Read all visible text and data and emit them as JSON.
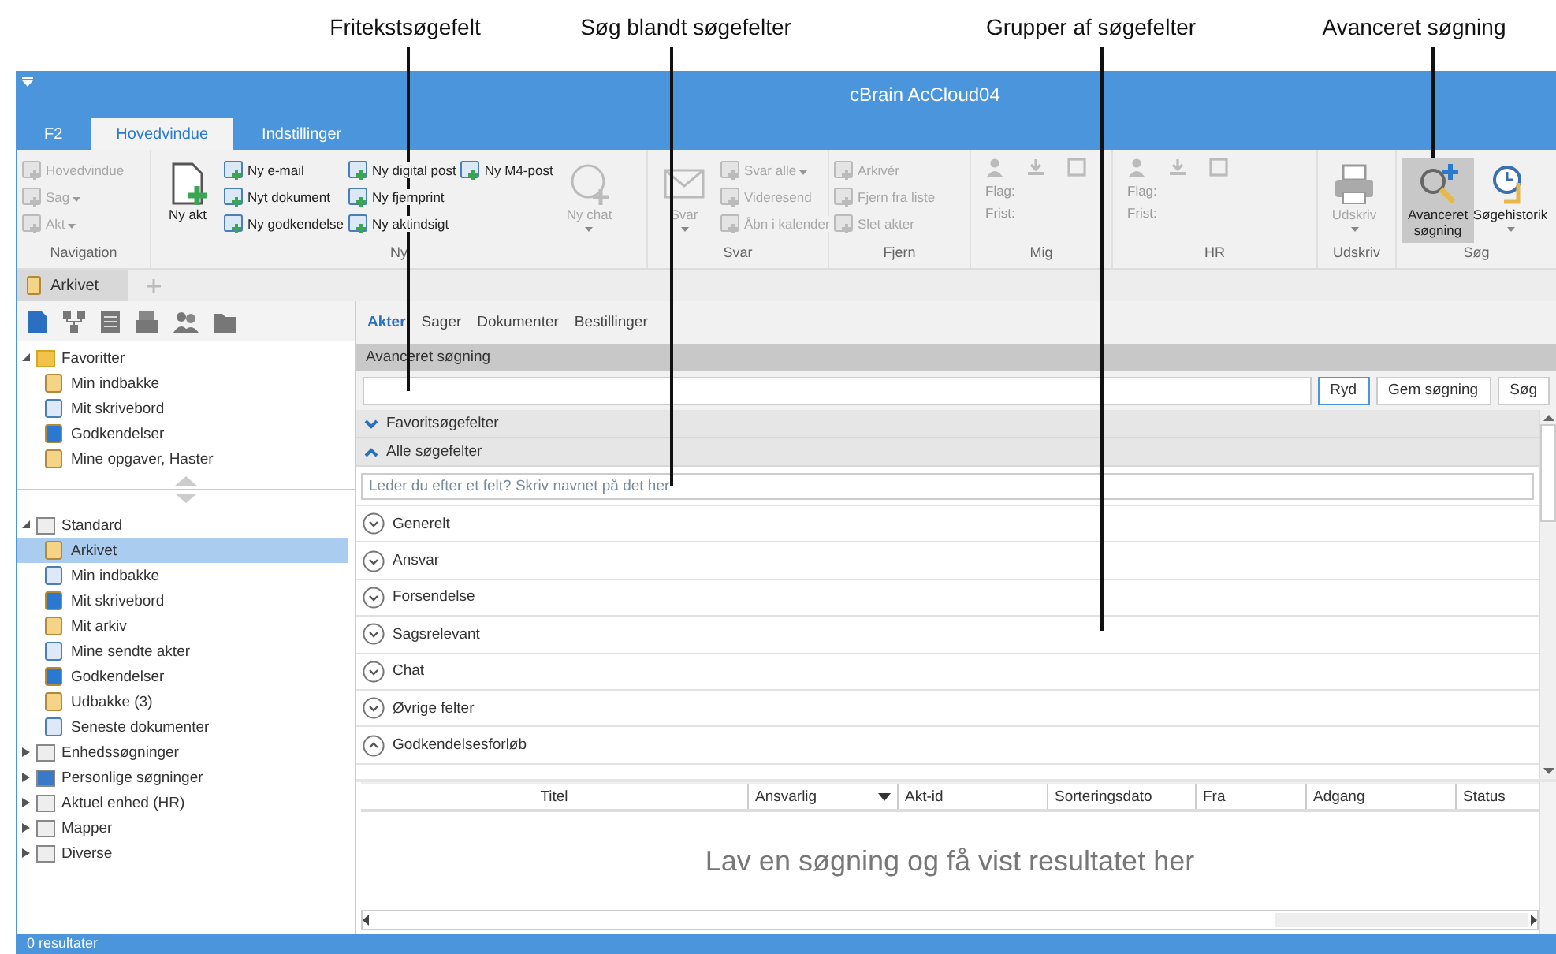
{
  "callouts": [
    {
      "label": "Fritekstsøgefelt"
    },
    {
      "label": "Søg blandt søgefelter"
    },
    {
      "label": "Grupper af søgefelter"
    },
    {
      "label": "Avanceret søgning"
    }
  ],
  "window": {
    "title": "cBrain AcCloud04"
  },
  "ribbon_tabs": [
    {
      "label": "F2",
      "selected": false
    },
    {
      "label": "Hovedvindue",
      "selected": true
    },
    {
      "label": "Indstillinger",
      "selected": false
    }
  ],
  "ribbon_groups": [
    {
      "label": "Navigation",
      "kind": "commands",
      "columns": [
        [
          {
            "kind": "small",
            "label": "Hovedvindue",
            "disabled": true,
            "dropdown": false
          },
          {
            "kind": "small",
            "label": "Sag",
            "disabled": true,
            "dropdown": true
          },
          {
            "kind": "small",
            "label": "Akt",
            "disabled": true,
            "dropdown": true
          }
        ]
      ]
    },
    {
      "label": "Ny",
      "kind": "commands",
      "columns": [
        [
          {
            "kind": "big",
            "label": "Ny akt",
            "disabled": false,
            "dropdown": false
          }
        ],
        [
          {
            "kind": "small",
            "label": "Ny e-mail",
            "disabled": false,
            "dropdown": false
          },
          {
            "kind": "small",
            "label": "Nyt dokument",
            "disabled": false,
            "dropdown": false
          },
          {
            "kind": "small",
            "label": "Ny godkendelse",
            "disabled": false,
            "dropdown": false
          }
        ],
        [
          {
            "kind": "small",
            "label": "Ny digital post",
            "disabled": false,
            "dropdown": false
          },
          {
            "kind": "small",
            "label": "Ny fjernprint",
            "disabled": false,
            "dropdown": false
          },
          {
            "kind": "small",
            "label": "Ny aktindsigt",
            "disabled": false,
            "dropdown": false
          }
        ],
        [
          {
            "kind": "small",
            "label": "Ny M4-post",
            "disabled": false,
            "dropdown": false
          }
        ],
        [
          {
            "kind": "big",
            "label": "Ny chat",
            "disabled": true,
            "dropdown": true
          }
        ]
      ]
    },
    {
      "label": "Svar",
      "kind": "commands",
      "columns": [
        [
          {
            "kind": "big",
            "label": "Svar",
            "disabled": true,
            "dropdown": true
          }
        ],
        [
          {
            "kind": "small",
            "label": "Svar alle",
            "disabled": true,
            "dropdown": true
          },
          {
            "kind": "small",
            "label": "Videresend",
            "disabled": true,
            "dropdown": false
          },
          {
            "kind": "small",
            "label": "Åbn i kalender",
            "disabled": true,
            "dropdown": false
          }
        ]
      ]
    },
    {
      "label": "Fjern",
      "kind": "commands",
      "columns": [
        [
          {
            "kind": "small",
            "label": "Arkivér",
            "disabled": true,
            "dropdown": false
          },
          {
            "kind": "small",
            "label": "Fjern fra liste",
            "disabled": true,
            "dropdown": false
          },
          {
            "kind": "small",
            "label": "Slet akter",
            "disabled": true,
            "dropdown": false
          }
        ]
      ]
    },
    {
      "label": "Mig",
      "kind": "flags",
      "columns": [
        [
          {
            "kind": "field",
            "label": "Flag:"
          },
          {
            "kind": "field",
            "label": "Frist:"
          }
        ]
      ]
    },
    {
      "label": "HR",
      "kind": "flags",
      "columns": [
        [
          {
            "kind": "field",
            "label": "Flag:"
          },
          {
            "kind": "field",
            "label": "Frist:"
          }
        ]
      ]
    },
    {
      "label": "Udskriv",
      "kind": "commands",
      "columns": [
        [
          {
            "kind": "big",
            "label": "Udskriv",
            "disabled": true,
            "dropdown": true
          }
        ]
      ]
    },
    {
      "label": "Søg",
      "kind": "commands",
      "columns": [
        [
          {
            "kind": "big",
            "label": "Avanceret søgning",
            "disabled": false,
            "dropdown": false,
            "selected": true
          }
        ],
        [
          {
            "kind": "big",
            "label": "Søgehistorik",
            "disabled": false,
            "dropdown": true,
            "selected": false
          }
        ]
      ]
    }
  ],
  "doc_tabs": [
    {
      "label": "Arkivet",
      "selected": true
    }
  ],
  "sidebar": {
    "sections": [
      {
        "label": "Favoritter",
        "expanded": true,
        "children": [
          {
            "label": "Min indbakke",
            "selected": false
          },
          {
            "label": "Mit skrivebord",
            "selected": false
          },
          {
            "label": "Godkendelser",
            "selected": false
          },
          {
            "label": "Mine opgaver, Haster",
            "selected": false
          }
        ]
      },
      {
        "label": "Standard",
        "expanded": true,
        "children": [
          {
            "label": "Arkivet",
            "selected": true
          },
          {
            "label": "Min indbakke",
            "selected": false
          },
          {
            "label": "Mit skrivebord",
            "selected": false
          },
          {
            "label": "Mit arkiv",
            "selected": false
          },
          {
            "label": "Mine sendte akter",
            "selected": false
          },
          {
            "label": "Godkendelser",
            "selected": false
          },
          {
            "label": "Udbakke (3)",
            "selected": false
          },
          {
            "label": "Seneste dokumenter",
            "selected": false
          }
        ]
      },
      {
        "label": "Enhedssøgninger",
        "expanded": false
      },
      {
        "label": "Personlige søgninger",
        "expanded": false
      },
      {
        "label": "Aktuel enhed (HR)",
        "expanded": false
      },
      {
        "label": "Mapper",
        "expanded": false
      },
      {
        "label": "Diverse",
        "expanded": false
      }
    ]
  },
  "sub_tabs": [
    {
      "label": "Akter",
      "selected": true
    },
    {
      "label": "Sager",
      "selected": false
    },
    {
      "label": "Dokumenter",
      "selected": false
    },
    {
      "label": "Bestillinger",
      "selected": false
    }
  ],
  "search": {
    "header": "Avanceret søgning",
    "buttons": [
      {
        "label": "Ryd",
        "selected": true
      },
      {
        "label": "Gem søgning",
        "selected": false
      },
      {
        "label": "Søg",
        "selected": false
      }
    ]
  },
  "panels": [
    {
      "label": "Favoritsøgefelter",
      "expanded": false
    },
    {
      "label": "Alle søgefelter",
      "expanded": true
    }
  ],
  "field_filter": {
    "placeholder": "Leder du efter et felt? Skriv navnet på det her"
  },
  "field_groups": [
    {
      "label": "Generelt",
      "expanded": false
    },
    {
      "label": "Ansvar",
      "expanded": false
    },
    {
      "label": "Forsendelse",
      "expanded": false
    },
    {
      "label": "Sagsrelevant",
      "expanded": false
    },
    {
      "label": "Chat",
      "expanded": false
    },
    {
      "label": "Øvrige felter",
      "expanded": false
    },
    {
      "label": "Godkendelsesforløb",
      "expanded": true
    }
  ],
  "table": {
    "columns": [
      {
        "label": "Titel",
        "sorted": false
      },
      {
        "label": "Ansvarlig",
        "sorted": true
      },
      {
        "label": "Akt-id",
        "sorted": false
      },
      {
        "label": "Sorteringsdato",
        "sorted": false
      },
      {
        "label": "Fra",
        "sorted": false
      },
      {
        "label": "Adgang",
        "sorted": false
      },
      {
        "label": "Status",
        "sorted": false
      }
    ],
    "empty_message": "Lav en søgning og få vist resultatet her"
  },
  "status_bar": {
    "text": "0 resultater"
  }
}
